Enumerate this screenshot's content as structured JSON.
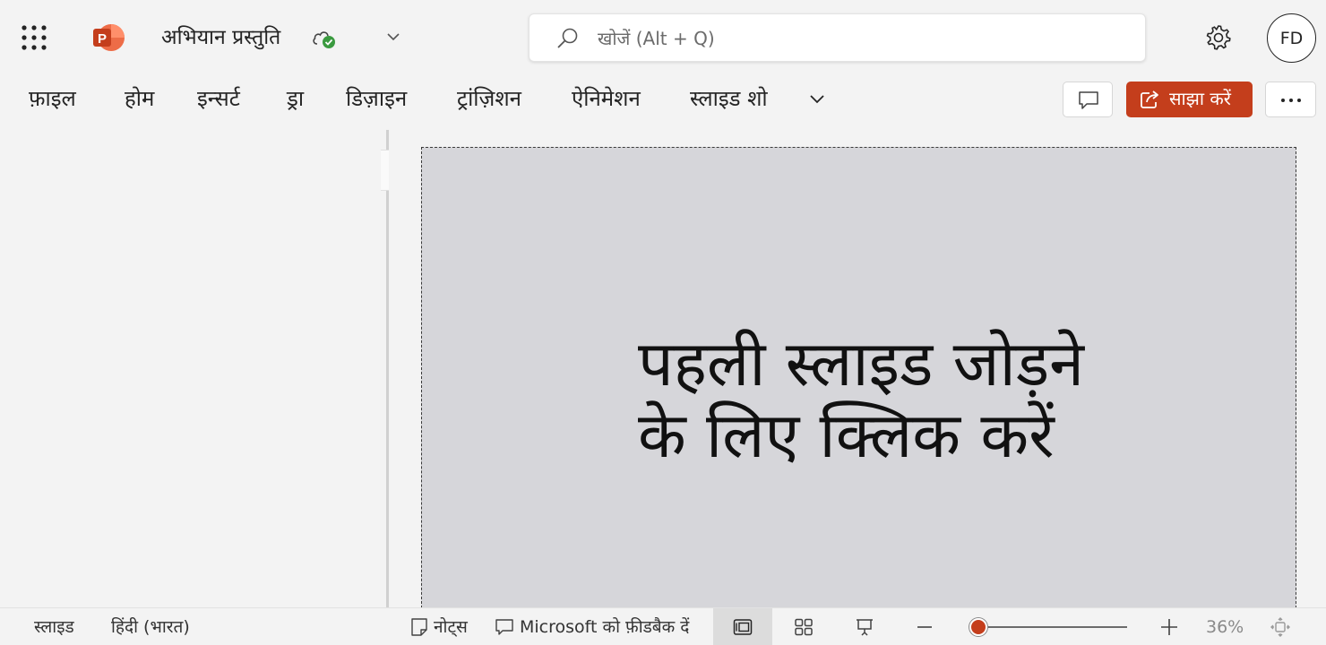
{
  "titlebar": {
    "doc_title": "अभियान प्रस्तुति",
    "search_placeholder": "खोजें (Alt + Q)",
    "avatar_initials": "FD"
  },
  "ribbon": {
    "tabs": [
      "फ़ाइल",
      "होम",
      "इन्सर्ट",
      "ड्रा",
      "डिज़ाइन",
      "ट्रांज़िशन",
      "ऐनिमेशन",
      "स्लाइड शो"
    ],
    "share_label": "साझा करें"
  },
  "slide": {
    "prompt": "पहली स्लाइड जोड़ने के लिए क्लिक करें"
  },
  "statusbar": {
    "slide_label": "स्लाइड",
    "language": "हिंदी (भारत)",
    "notes_label": "नोट्स",
    "feedback_label": "Microsoft को फ़ीडबैक दें",
    "zoom_level": "36%",
    "zoom_fraction": 0.0
  },
  "colors": {
    "accent": "#c43e1c",
    "slide_bg": "#d6d6da",
    "cloud_check": "#3a9a3f"
  },
  "icons": [
    "apps-grid-icon",
    "powerpoint-logo-icon",
    "cloud-saved-icon",
    "chevron-down-icon",
    "search-icon",
    "gear-icon",
    "comment-icon",
    "share-icon",
    "more-icon",
    "collapse-pane-icon",
    "notes-icon",
    "feedback-icon",
    "normal-view-icon",
    "slide-sorter-icon",
    "reading-view-icon",
    "zoom-out-icon",
    "zoom-in-icon",
    "fit-to-window-icon"
  ]
}
